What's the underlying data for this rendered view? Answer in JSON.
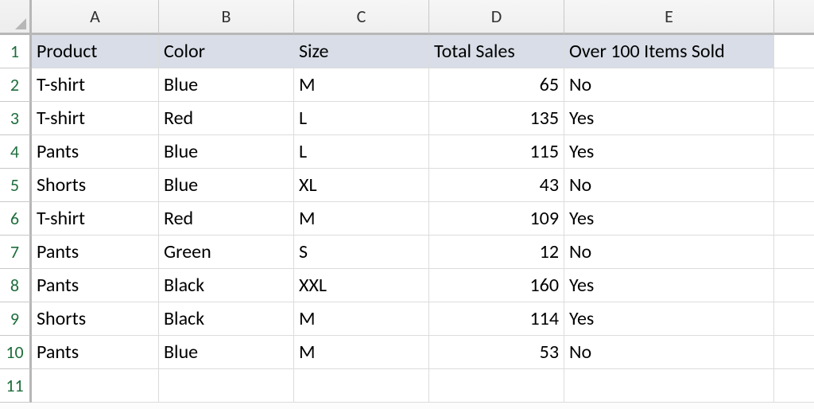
{
  "columns": {
    "A": "A",
    "B": "B",
    "C": "C",
    "D": "D",
    "E": "E"
  },
  "rowNumbers": [
    "1",
    "2",
    "3",
    "4",
    "5",
    "6",
    "7",
    "8",
    "9",
    "10",
    "11"
  ],
  "header": {
    "product": "Product",
    "color": "Color",
    "size": "Size",
    "total_sales": "Total Sales",
    "over100": "Over 100 Items Sold"
  },
  "rows": [
    {
      "product": "T-shirt",
      "color": "Blue",
      "size": "M",
      "total_sales": "65",
      "over100": "No"
    },
    {
      "product": "T-shirt",
      "color": "Red",
      "size": "L",
      "total_sales": "135",
      "over100": "Yes"
    },
    {
      "product": "Pants",
      "color": "Blue",
      "size": "L",
      "total_sales": "115",
      "over100": "Yes"
    },
    {
      "product": "Shorts",
      "color": "Blue",
      "size": "XL",
      "total_sales": "43",
      "over100": "No"
    },
    {
      "product": "T-shirt",
      "color": "Red",
      "size": "M",
      "total_sales": "109",
      "over100": "Yes"
    },
    {
      "product": "Pants",
      "color": "Green",
      "size": "S",
      "total_sales": "12",
      "over100": "No"
    },
    {
      "product": "Pants",
      "color": "Black",
      "size": "XXL",
      "total_sales": "160",
      "over100": "Yes"
    },
    {
      "product": "Shorts",
      "color": "Black",
      "size": "M",
      "total_sales": "114",
      "over100": "Yes"
    },
    {
      "product": "Pants",
      "color": "Blue",
      "size": "M",
      "total_sales": "53",
      "over100": "No"
    }
  ]
}
